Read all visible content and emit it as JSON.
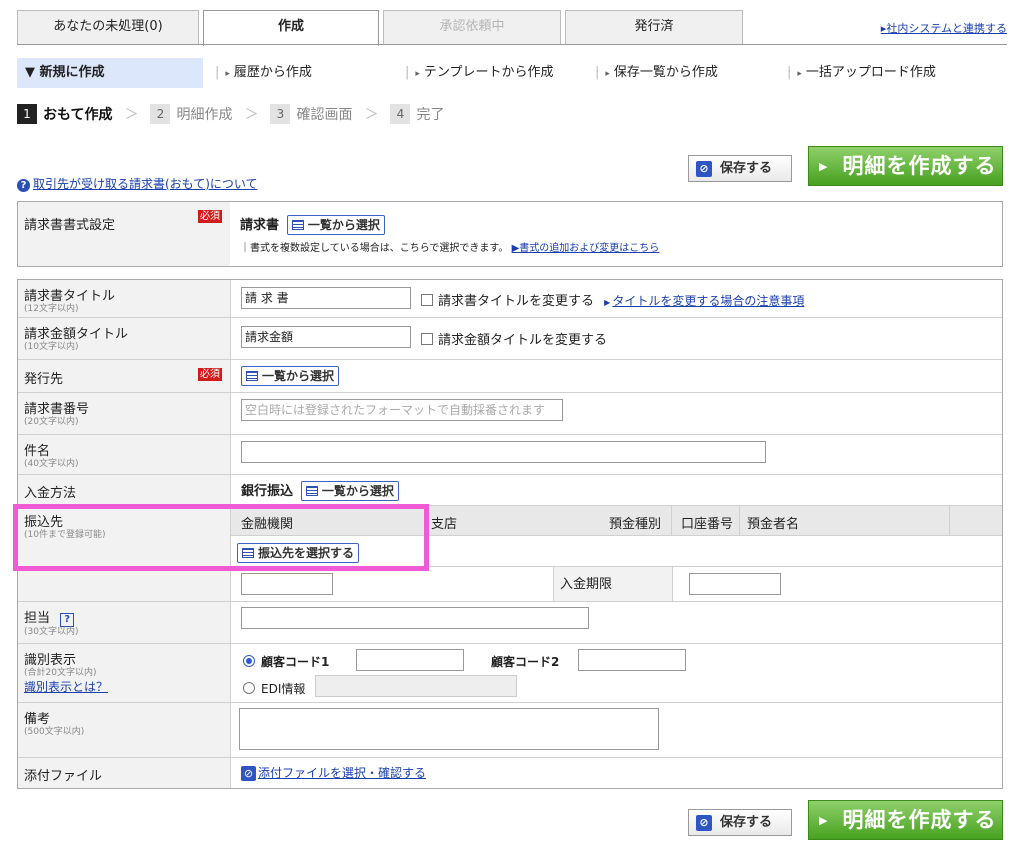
{
  "tabs": {
    "unprocessed": "あなたの未処理(0)",
    "create": "作成",
    "approval": "承認依頼中",
    "issued": "発行済",
    "link": "▸社内システムと連携する"
  },
  "subnav": {
    "new": "▼ 新規に作成",
    "history": "履歴から作成",
    "template": "テンプレートから作成",
    "saved": "保存一覧から作成",
    "bulk": "一括アップロード作成"
  },
  "steps": [
    {
      "num": "1",
      "label": "おもて作成"
    },
    {
      "num": "2",
      "label": "明細作成"
    },
    {
      "num": "3",
      "label": "確認画面"
    },
    {
      "num": "4",
      "label": "完了"
    }
  ],
  "buttons": {
    "save": "保存する",
    "create_detail": "明細を作成する",
    "select_from_list": "一覧から選択",
    "select_account": "振込先を選択する"
  },
  "help_link": "取引先が受け取る請求書(おもて)について",
  "required": "必須",
  "format": {
    "label": "請求書書式設定",
    "value": "請求書",
    "note": "｜書式を複数設定している場合は、こちらで選択できます。",
    "note_link": "▶書式の追加および変更はこちら"
  },
  "form": {
    "title": {
      "label": "請求書タイトル",
      "sub": "(12文字以内)",
      "value": "請 求 書",
      "checkbox": "請求書タイトルを変更する",
      "link": "タイトルを変更する場合の注意事項"
    },
    "amount_title": {
      "label": "請求金額タイトル",
      "sub": "(10文字以内)",
      "value": "請求金額",
      "checkbox": "請求金額タイトルを変更する"
    },
    "issue_to": {
      "label": "発行先"
    },
    "number": {
      "label": "請求書番号",
      "sub": "(20文字以内)",
      "placeholder": "空白時には登録されたフォーマットで自動採番されます"
    },
    "subject": {
      "label": "件名",
      "sub": "(40文字以内)"
    },
    "payment": {
      "label": "入金方法",
      "value": "銀行振込"
    },
    "account": {
      "label": "振込先",
      "sub": "(10件まで登録可能)",
      "cols": [
        "金融機関",
        "支店",
        "預金種別",
        "口座番号",
        "預金者名"
      ]
    },
    "date": {
      "due_label": "入金期限"
    },
    "person": {
      "label": "担当",
      "sub": "(30文字以内)",
      "help": "?"
    },
    "ident": {
      "label": "識別表示",
      "sub": "(合計20文字以内)",
      "link": "識別表示とは？",
      "code1": "顧客コード1",
      "code2": "顧客コード2",
      "edi": "EDI情報"
    },
    "memo": {
      "label": "備考",
      "sub": "(500文字以内)"
    },
    "attach": {
      "label": "添付ファイル",
      "link": "添付ファイルを選択・確認する"
    }
  }
}
